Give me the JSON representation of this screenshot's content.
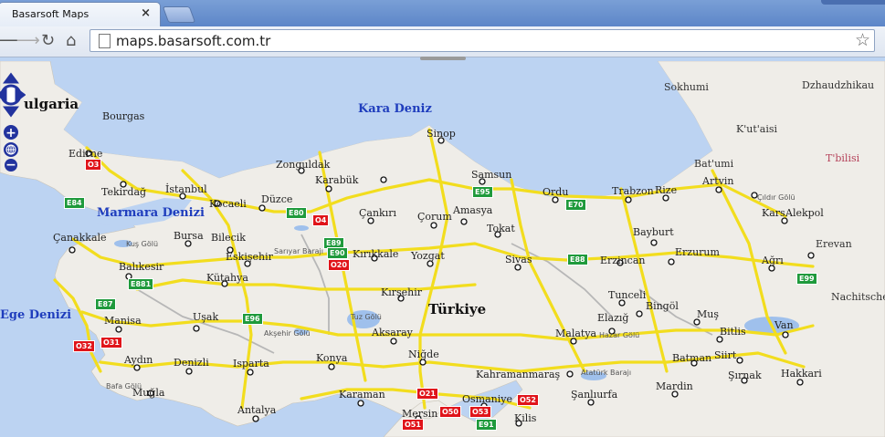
{
  "browser": {
    "tab_title": "Basarsoft Maps",
    "tab_close": "×",
    "url": "maps.basarsoft.com.tr",
    "back_icon": "back-arrow-icon",
    "forward_icon": "forward-arrow-icon",
    "reload_icon": "reload-icon",
    "home_icon": "home-icon",
    "bookmark_icon": "star-icon"
  },
  "map_controls": {
    "pan_icon": "pan-arrows-icon",
    "zoom_in": "+",
    "zoom_out": "−",
    "globe_icon": "globe-icon"
  },
  "colors": {
    "sea": "#bcd3f2",
    "land": "#efede8",
    "road": "#f4e22a",
    "e_road": "#1f9a3c",
    "o_road": "#e0141a"
  },
  "labels": {
    "seas": [
      "Kara Deniz",
      "Marmara Denizi",
      "Ege Denizi"
    ],
    "country": "Türkiye",
    "bulgaria": "ulgaria",
    "foreign": [
      "Sokhumi",
      "Dzhaudzhikau",
      "K'ut'aisi",
      "Bat'umi",
      "Erevan",
      "Nachitsche"
    ],
    "tbilisi": "T'bilisi",
    "cities": [
      "Bourgas",
      "Edirne",
      "Tekirdağ",
      "İstanbul",
      "Kocaeli",
      "Düzce",
      "Zonguldak",
      "Karabük",
      "Sinop",
      "Samsun",
      "Ordu",
      "Trabzon",
      "Rize",
      "Artvin",
      "Çankırı",
      "Çorum",
      "Amasya",
      "Tokat",
      "Kars",
      "Alekpol",
      "Çanakkale",
      "Bursa",
      "Bilecik",
      "Eskişehir",
      "Kırıkkale",
      "Yozgat",
      "Sivas",
      "Erzincan",
      "Bayburt",
      "Erzurum",
      "Ağrı",
      "Balıkesir",
      "Kütahya",
      "Kırşehir",
      "Tunceli",
      "Bingöl",
      "Muş",
      "Manisa",
      "Uşak",
      "Aksaray",
      "Elazığ",
      "Bitlis",
      "Van",
      "Malatya",
      "Niğde",
      "Aydın",
      "Denizli",
      "Isparta",
      "Konya",
      "Kahramanmaraş",
      "Batman",
      "Siirt",
      "Şırnak",
      "Hakkari",
      "Muğla",
      "Karaman",
      "Osmaniye",
      "Şanlıurfa",
      "Mardin",
      "Antalya",
      "Mersin",
      "Kilis"
    ],
    "waters": [
      "Çıldır Gölü",
      "Kuş Gölü",
      "Sarıyar Barajı",
      "Tuz Gölü",
      "Akşehir Gölü",
      "Hazar Gölü",
      "Atatürk Barajı",
      "Bafa Gölü"
    ]
  },
  "road_shields": {
    "e": [
      "E84",
      "E80",
      "E89",
      "E90",
      "E95",
      "E70",
      "E88",
      "E99",
      "E881",
      "E87",
      "E96",
      "E91"
    ],
    "o": [
      "O3",
      "O4",
      "O20",
      "O32",
      "O31",
      "O21",
      "O50",
      "O53",
      "O52",
      "O51"
    ]
  }
}
